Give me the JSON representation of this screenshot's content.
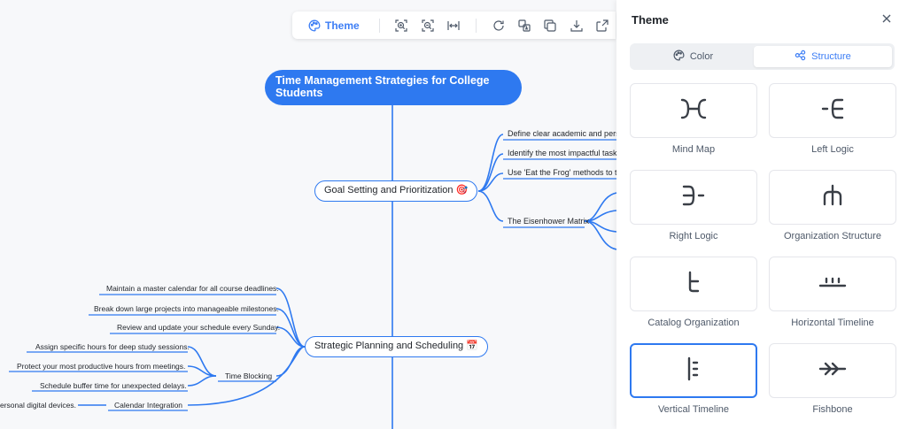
{
  "toolbar": {
    "theme_label": "Theme",
    "icons": [
      "zoom-in-icon",
      "zoom-out-icon",
      "fit-width-icon",
      "refresh-icon",
      "format-icon",
      "copy-icon",
      "download-icon",
      "share-icon"
    ]
  },
  "mindmap": {
    "root": "Time Management Strategies for College Students",
    "branches": [
      {
        "label": "Goal Setting and Prioritization 🎯",
        "children": [
          "Define clear academic and person",
          "Identify the most impactful tasks f",
          "Use 'Eat the Frog' methods to tack",
          "The Eisenhower Matrix"
        ]
      },
      {
        "label": "Strategic Planning and Scheduling 📅",
        "children": [
          "Maintain a master calendar for all course deadlines.",
          "Break down large projects into manageable milestones.",
          "Review and update your schedule every Sunday.",
          "Time Blocking",
          "Calendar Integration"
        ],
        "time_blocking": [
          "Assign specific hours for deep study sessions.",
          "Protect your most productive hours from meetings.",
          "Schedule buffer time for unexpected delays."
        ],
        "calendar_integration": [
          "ersonal digital devices."
        ]
      }
    ]
  },
  "panel": {
    "title": "Theme",
    "tabs": {
      "color": "Color",
      "structure": "Structure"
    },
    "active_tab": "structure",
    "structures": [
      {
        "label": "Mind Map",
        "icon": "mind-map-icon"
      },
      {
        "label": "Left Logic",
        "icon": "left-logic-icon"
      },
      {
        "label": "Right Logic",
        "icon": "right-logic-icon"
      },
      {
        "label": "Organization Structure",
        "icon": "organization-structure-icon"
      },
      {
        "label": "Catalog Organization",
        "icon": "catalog-organization-icon"
      },
      {
        "label": "Horizontal Timeline",
        "icon": "horizontal-timeline-icon"
      },
      {
        "label": "Vertical Timeline",
        "icon": "vertical-timeline-icon"
      },
      {
        "label": "Fishbone",
        "icon": "fishbone-icon"
      }
    ],
    "selected_structure": "Vertical Timeline"
  },
  "colors": {
    "accent": "#2e79f0",
    "line": "#2e79f0",
    "selected_border": "#2e79f0"
  }
}
